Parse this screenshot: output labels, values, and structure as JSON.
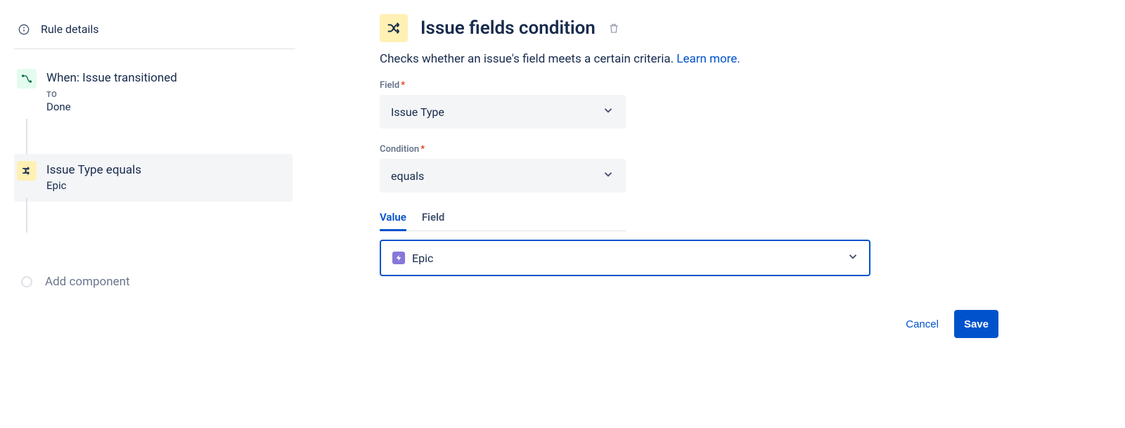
{
  "sidebar": {
    "rule_details_label": "Rule details",
    "trigger": {
      "title": "When: Issue transitioned",
      "sub_label": "TO",
      "sub_value": "Done"
    },
    "condition": {
      "title": "Issue Type equals",
      "sub_value": "Epic"
    },
    "add_component_label": "Add component"
  },
  "main": {
    "title": "Issue fields condition",
    "description": "Checks whether an issue's field meets a certain criteria. ",
    "learn_more": "Learn more.",
    "field_label": "Field",
    "field_value": "Issue Type",
    "condition_label": "Condition",
    "condition_value": "equals",
    "tabs": {
      "value": "Value",
      "field": "Field"
    },
    "value_selected": "Epic",
    "actions": {
      "cancel": "Cancel",
      "save": "Save"
    }
  }
}
